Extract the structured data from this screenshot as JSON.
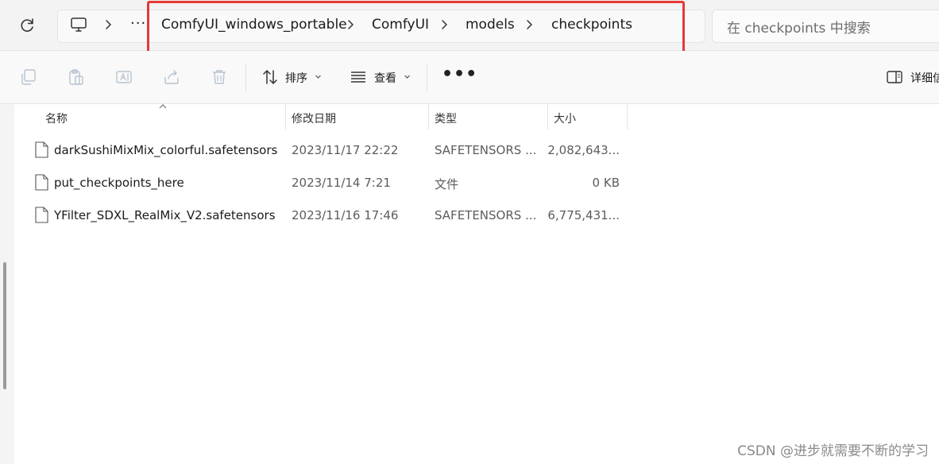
{
  "address_bar": {
    "overflow_label": "···",
    "breadcrumbs": [
      {
        "label": "ComfyUI_windows_portable"
      },
      {
        "label": "ComfyUI"
      },
      {
        "label": "models"
      },
      {
        "label": "checkpoints"
      }
    ],
    "search_placeholder": "在 checkpoints 中搜索"
  },
  "toolbar": {
    "sort_label": "排序",
    "view_label": "查看",
    "more_label": "•••",
    "details_label": "详细信息"
  },
  "columns": {
    "name": "名称",
    "modified": "修改日期",
    "type": "类型",
    "size": "大小"
  },
  "files": [
    {
      "name": "darkSushiMixMix_colorful.safetensors",
      "modified": "2023/11/17 22:22",
      "type": "SAFETENSORS ...",
      "size": "2,082,643..."
    },
    {
      "name": "put_checkpoints_here",
      "modified": "2023/11/14 7:21",
      "type": "文件",
      "size": "0 KB"
    },
    {
      "name": "YFilter_SDXL_RealMix_V2.safetensors",
      "modified": "2023/11/16 17:46",
      "type": "SAFETENSORS ...",
      "size": "6,775,431..."
    }
  ],
  "watermark": "CSDN @进步就需要不断的学习",
  "colors": {
    "highlight": "#e53935",
    "toolbar_bg": "#f9f9f9",
    "address_bg": "#f3f3f3"
  }
}
